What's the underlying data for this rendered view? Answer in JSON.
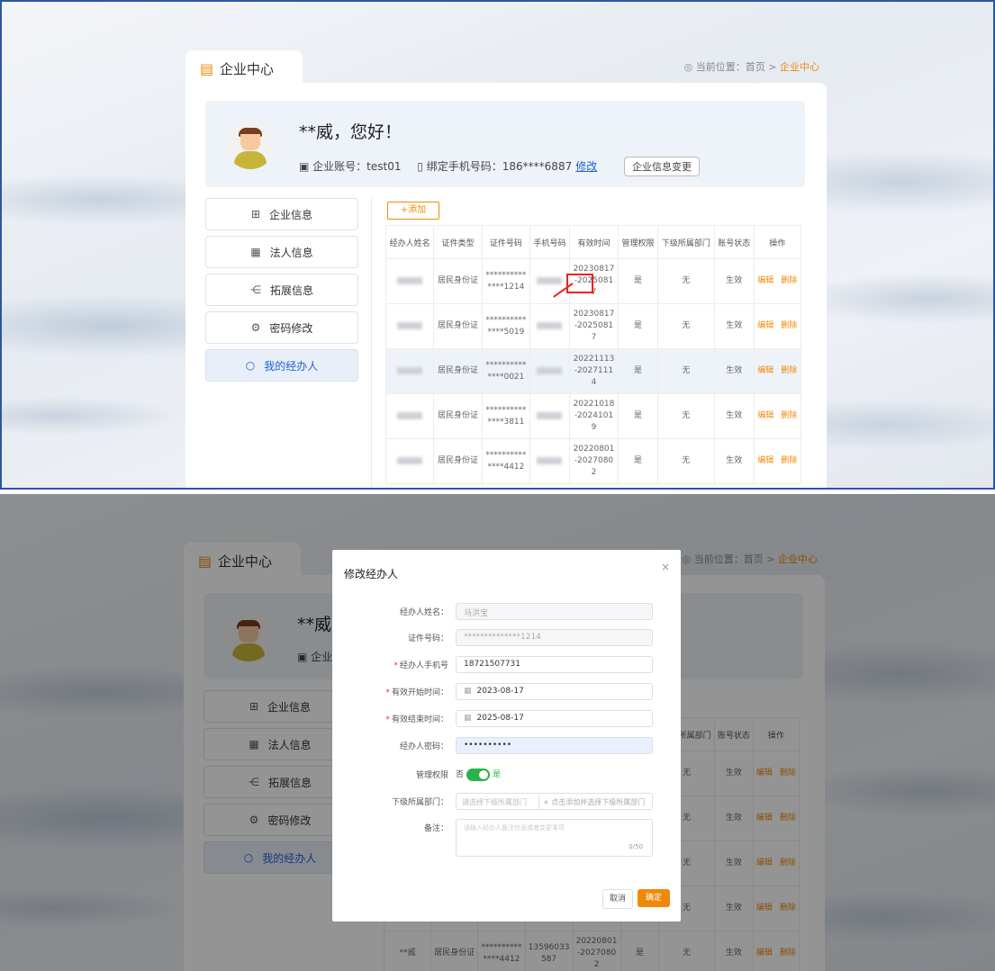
{
  "page": {
    "title": "企业中心",
    "breadcrumb": {
      "label": "当前位置：",
      "home": "首页",
      "sep": ">",
      "current": "企业中心"
    }
  },
  "profile": {
    "greeting": "**威，您好！",
    "account_label": "企业账号：",
    "account": "test01",
    "phone_label": "绑定手机号码：",
    "phone": "186****6887",
    "modify_link": "修改",
    "change_button": "企业信息变更"
  },
  "sidebar": {
    "items": [
      {
        "label": "企业信息",
        "icon": "building-icon"
      },
      {
        "label": "法人信息",
        "icon": "id-card-icon"
      },
      {
        "label": "拓展信息",
        "icon": "share-icon"
      },
      {
        "label": "密码修改",
        "icon": "gear-icon"
      },
      {
        "label": "我的经办人",
        "icon": "refresh-icon",
        "active": true
      }
    ]
  },
  "agents": {
    "add_button": "+添加",
    "columns": [
      "经办人姓名",
      "证件类型",
      "证件号码",
      "手机号码",
      "有效时间",
      "管理权限",
      "下级所属部门",
      "账号状态",
      "操作"
    ],
    "rows": [
      {
        "id_type": "居民身份证",
        "id_no_1": "**********",
        "id_no_2": "****1214",
        "valid_1": "20230817",
        "valid_2": "-2025081",
        "valid_3": "7",
        "admin": "是",
        "dept": "无",
        "status": "生效",
        "edit": "编辑",
        "delete": "删除"
      },
      {
        "id_type": "居民身份证",
        "id_no_1": "**********",
        "id_no_2": "****5019",
        "valid_1": "20230817",
        "valid_2": "-2025081",
        "valid_3": "7",
        "admin": "是",
        "dept": "无",
        "status": "生效",
        "edit": "编辑",
        "delete": "删除"
      },
      {
        "id_type": "居民身份证",
        "id_no_1": "**********",
        "id_no_2": "****0021",
        "valid_1": "20221113",
        "valid_2": "-2027111",
        "valid_3": "4",
        "admin": "是",
        "dept": "无",
        "status": "生效",
        "edit": "编辑",
        "delete": "删除"
      },
      {
        "id_type": "居民身份证",
        "id_no_1": "**********",
        "id_no_2": "****3811",
        "valid_1": "20221018",
        "valid_2": "-2024101",
        "valid_3": "9",
        "admin": "是",
        "dept": "无",
        "status": "生效",
        "edit": "编辑",
        "delete": "删除"
      },
      {
        "id_type": "居民身份证",
        "id_no_1": "**********",
        "id_no_2": "****4412",
        "valid_1": "20220801",
        "valid_2": "-2027080",
        "valid_3": "2",
        "admin": "是",
        "dept": "无",
        "status": "生效",
        "edit": "编辑",
        "delete": "删除"
      }
    ],
    "bottom_row_screen2": {
      "name": "**威",
      "phone_1": "13596033",
      "phone_2": "587"
    }
  },
  "modal": {
    "title": "修改经办人",
    "close": "×",
    "name_label": "经办人姓名：",
    "name_value": "马洪宝",
    "idno_label": "证件号码：",
    "idno_value": "**************1214",
    "phone_label": "经办人手机号",
    "phone_value": "18721507731",
    "start_label": "有效开始时间：",
    "start_value": "2023-08-17",
    "end_label": "有效结束时间：",
    "end_value": "2025-08-17",
    "pwd_label": "经办人密码：",
    "pwd_value": "••••••••••",
    "admin_label": "管理权限",
    "admin_no": "否",
    "admin_yes": "是",
    "dept_label": "下级所属部门：",
    "dept_placeholder": "请选择下级所属部门",
    "dept_add": "+ 点击添加并选择下级所属部门",
    "remark_label": "备注：",
    "remark_placeholder": "请输入经办人备注信息或者变更事项",
    "remark_count": "0/50",
    "cancel": "取消",
    "ok": "确定"
  },
  "colors": {
    "accent": "#f0890a",
    "link": "#1f5fd8",
    "toggle_on": "#29b14a",
    "frame": "#2d54a6"
  }
}
